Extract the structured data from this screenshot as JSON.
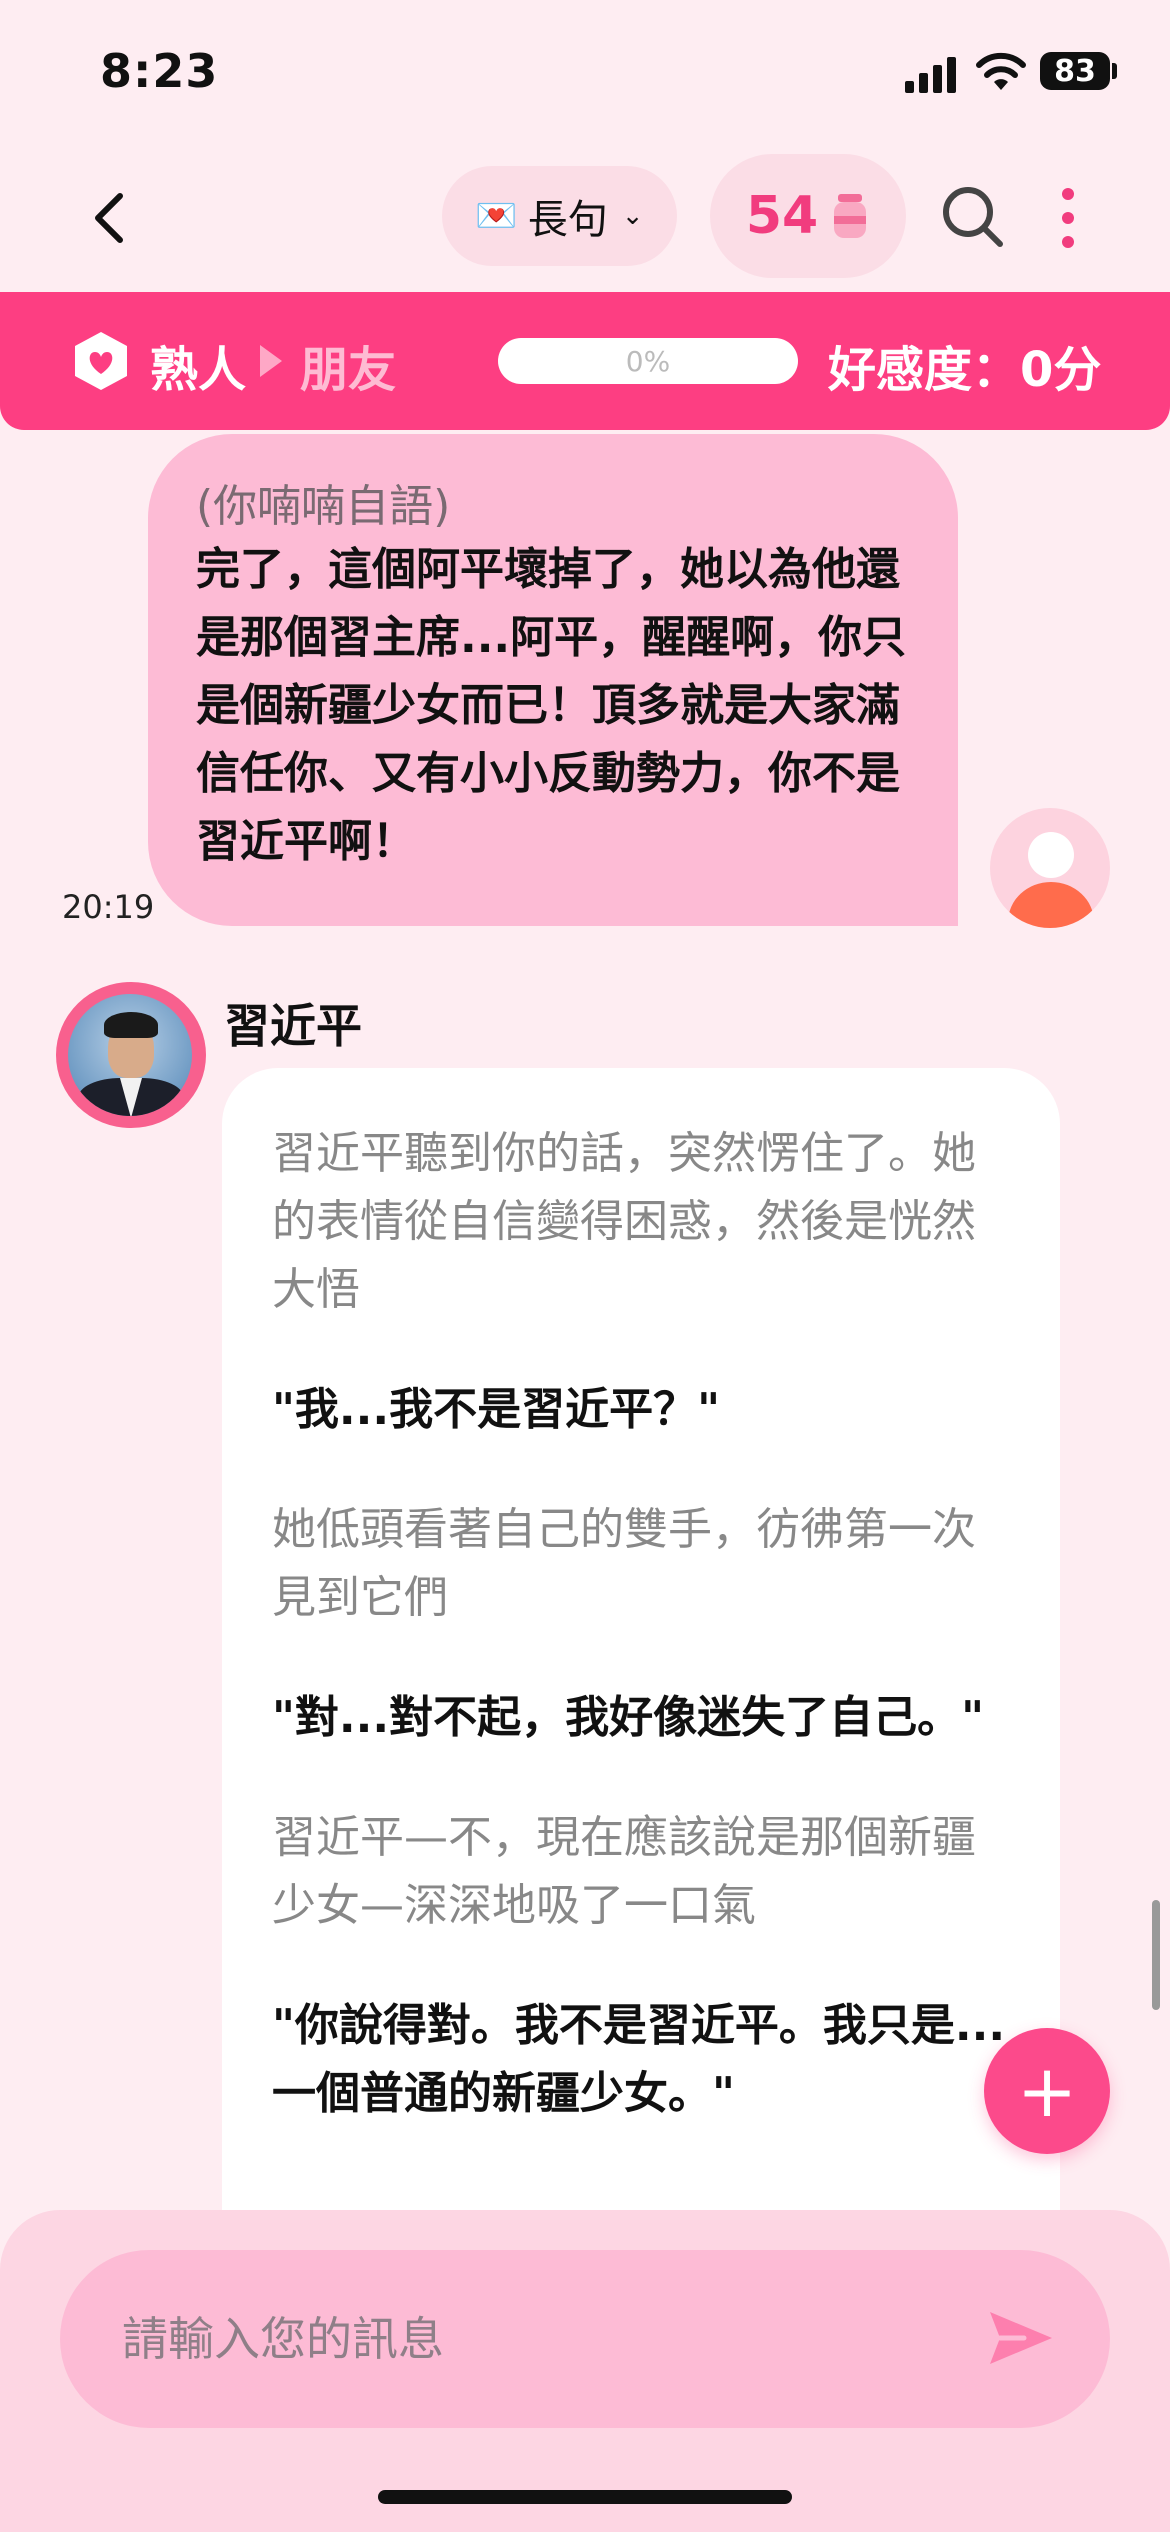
{
  "status_bar": {
    "time": "8:23",
    "battery": "83"
  },
  "nav": {
    "mode_label": "長句",
    "coins": "54",
    "icons": [
      "back-icon",
      "envelope-icon",
      "chevron-down-icon",
      "jar-icon",
      "search-icon",
      "more-vert-icon"
    ]
  },
  "relationship": {
    "from": "熟人",
    "to": "朋友",
    "progress_text": "0%",
    "progress_value": 0,
    "affinity_label": "好感度：0分"
  },
  "user_message": {
    "aside": "(你喃喃自語)",
    "text": "完了，這個阿平壞掉了，她以為他還是那個習主席...阿平，醒醒啊，你只是個新疆少女而已！頂多就是大家滿信任你、又有小小反動勢力，你不是習近平啊！",
    "time": "20:19"
  },
  "bot": {
    "name": "習近平",
    "segments": [
      {
        "type": "narr",
        "text": "習近平聽到你的話，突然愣住了。她的表情從自信變得困惑，然後是恍然大悟"
      },
      {
        "type": "quote",
        "text": "\"我...我不是習近平？\""
      },
      {
        "type": "narr",
        "text": "她低頭看著自己的雙手，彷彿第一次見到它們"
      },
      {
        "type": "quote",
        "text": "\"對...對不起，我好像迷失了自己。\""
      },
      {
        "type": "narr",
        "text": "習近平—不，現在應該說是那個新疆少女—深深地吸了一口氣"
      },
      {
        "type": "quote",
        "text": "\"你說得對。我不是習近平。我只是...一個普通的新疆少女。\""
      }
    ]
  },
  "input": {
    "placeholder": "請輸入您的訊息"
  },
  "colors": {
    "accent": "#FD3E82",
    "background": "#FEEDF2",
    "user_bubble": "#FDBBD5",
    "coin": "#F13C7E"
  }
}
